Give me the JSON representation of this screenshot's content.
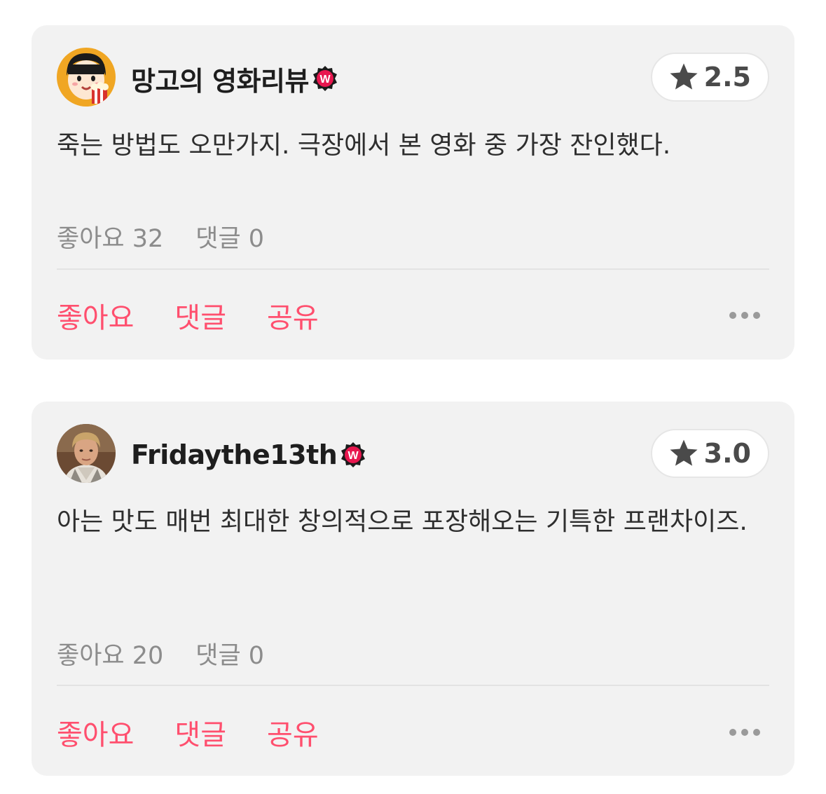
{
  "colors": {
    "card_background": "#f2f2f2",
    "accent": "#ff4f6e",
    "muted_text": "#8c8c8c",
    "badge": "#e8174f"
  },
  "reviews": [
    {
      "username": "망고의 영화리뷰",
      "avatar_icon": "cartoon-girl-popcorn-avatar",
      "badge_icon": "watcha-verified-badge-icon",
      "rating": "2.5",
      "text": "죽는 방법도 오만가지. 극장에서 본 영화 중 가장 잔인했다.",
      "like_count_label": "좋아요 32",
      "comment_count_label": "댓글 0",
      "actions": {
        "like": "좋아요",
        "comment": "댓글",
        "share": "공유"
      }
    },
    {
      "username": "Fridaythe13th",
      "avatar_icon": "man-portrait-avatar",
      "badge_icon": "watcha-verified-badge-icon",
      "rating": "3.0",
      "text": "아는 맛도 매번 최대한 창의적으로 포장해오는 기특한 프랜차이즈.",
      "like_count_label": "좋아요 20",
      "comment_count_label": "댓글 0",
      "actions": {
        "like": "좋아요",
        "comment": "댓글",
        "share": "공유"
      }
    }
  ]
}
